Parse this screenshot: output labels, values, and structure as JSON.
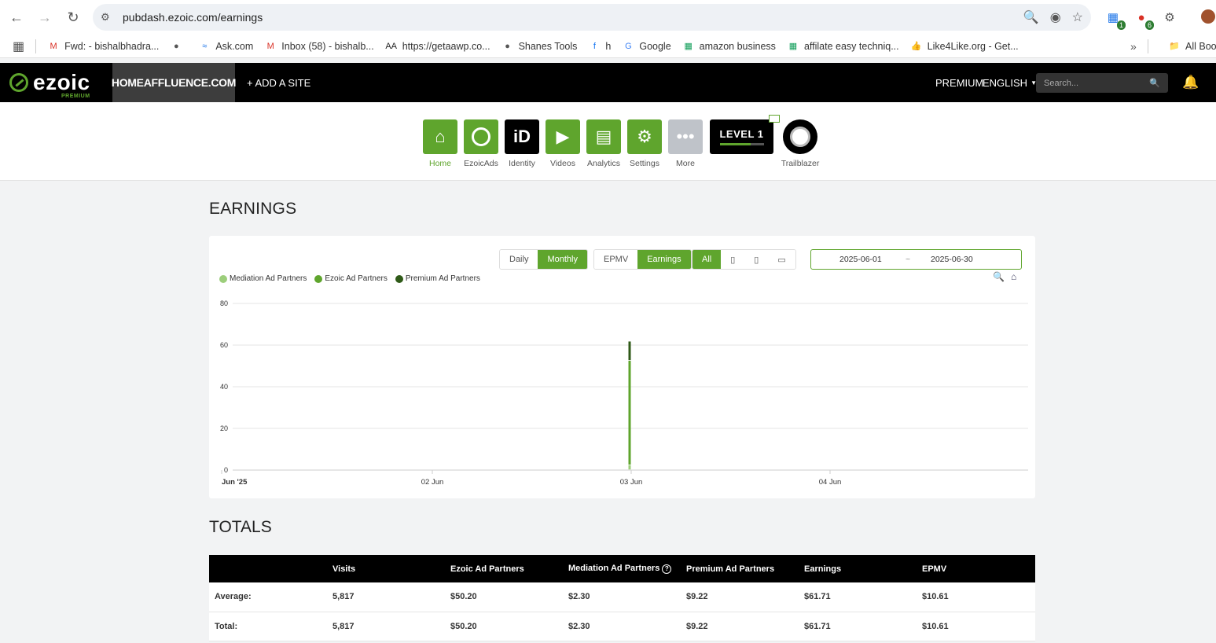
{
  "browser": {
    "url": "pubdash.ezoic.com/earnings",
    "extensions": [
      {
        "name": "puzzle-ext",
        "badge": "1"
      },
      {
        "name": "red-ext",
        "badge": "6"
      }
    ],
    "bookmarks": [
      {
        "label": "Fwd: - bishalbhadra...",
        "icon": "gmail-icon",
        "color": "#d93025"
      },
      {
        "label": "",
        "icon": "globe-icon",
        "color": "#555555"
      },
      {
        "label": "Ask.com",
        "icon": "ask-icon",
        "color": "#1a73e8"
      },
      {
        "label": "Inbox (58) - bishalb...",
        "icon": "gmail-icon",
        "color": "#d93025"
      },
      {
        "label": "https://getaawp.co...",
        "icon": "aawp-icon",
        "color": "#222222"
      },
      {
        "label": "Shanes Tools",
        "icon": "globe-icon",
        "color": "#555555"
      },
      {
        "label": "h",
        "icon": "facebook-icon",
        "color": "#1877f2"
      },
      {
        "label": "Google",
        "icon": "google-icon",
        "color": "#4285f4"
      },
      {
        "label": "amazon business",
        "icon": "sheet-icon",
        "color": "#0f9d58"
      },
      {
        "label": "affilate easy techniq...",
        "icon": "sheet-icon",
        "color": "#0f9d58"
      },
      {
        "label": "Like4Like.org - Get...",
        "icon": "thumb-icon",
        "color": "#3b5998"
      }
    ],
    "all_bookmarks": "All Boo"
  },
  "header": {
    "logo": "ezoic",
    "logo_sub": "PREMIUM",
    "site": "HOMEAFFLUENCE.COM",
    "add_site": "+ ADD A SITE",
    "premium": "PREMIUM",
    "language": "ENGLISH",
    "search_placeholder": "Search..."
  },
  "apps": [
    {
      "label": "Home",
      "icon": "home-icon"
    },
    {
      "label": "EzoicAds",
      "icon": "ezoicads-icon"
    },
    {
      "label": "Identity",
      "icon": "identity-icon"
    },
    {
      "label": "Videos",
      "icon": "videos-icon"
    },
    {
      "label": "Analytics",
      "icon": "analytics-icon"
    },
    {
      "label": "Settings",
      "icon": "gear-icon"
    },
    {
      "label": "More",
      "icon": "more-icon"
    },
    {
      "label": "Trailblazer",
      "icon": "trailblazer-icon"
    }
  ],
  "level": {
    "label": "LEVEL 1",
    "progress": 0.7
  },
  "earnings": {
    "title": "EARNINGS",
    "period_toggle": [
      "Daily",
      "Monthly"
    ],
    "period_selected": "Monthly",
    "metric_toggle": [
      "EPMV",
      "Earnings"
    ],
    "metric_selected": "Earnings",
    "device_toggle": {
      "all": "All",
      "devices": [
        "tablet-icon",
        "mobile-icon",
        "desktop-icon"
      ]
    },
    "date_from": "2025-06-01",
    "date_sep": "~",
    "date_to": "2025-06-30"
  },
  "chart_data": {
    "type": "bar",
    "stacked": true,
    "categories": [
      "Jun '25",
      "02 Jun",
      "03 Jun",
      "04 Jun"
    ],
    "series": [
      {
        "name": "Mediation Ad Partners",
        "color": "#9cce7b",
        "values": [
          0,
          0,
          2.3,
          0
        ]
      },
      {
        "name": "Ezoic Ad Partners",
        "color": "#5fa52d",
        "values": [
          0,
          0,
          50.2,
          0
        ]
      },
      {
        "name": "Premium Ad Partners",
        "color": "#2f5a18",
        "values": [
          0,
          0,
          9.22,
          0
        ]
      }
    ],
    "yticks": [
      0,
      20,
      40,
      60,
      80
    ],
    "ylim": [
      0,
      80
    ],
    "grid": true,
    "legend": "top-left"
  },
  "totals": {
    "title": "TOTALS",
    "columns": [
      "",
      "Visits",
      "Ezoic Ad Partners",
      "Mediation Ad Partners",
      "Premium Ad Partners",
      "Earnings",
      "EPMV"
    ],
    "rows": [
      [
        "Average:",
        "5,817",
        "$50.20",
        "$2.30",
        "$9.22",
        "$61.71",
        "$10.61"
      ],
      [
        "Total:",
        "5,817",
        "$50.20",
        "$2.30",
        "$9.22",
        "$61.71",
        "$10.61"
      ]
    ]
  }
}
